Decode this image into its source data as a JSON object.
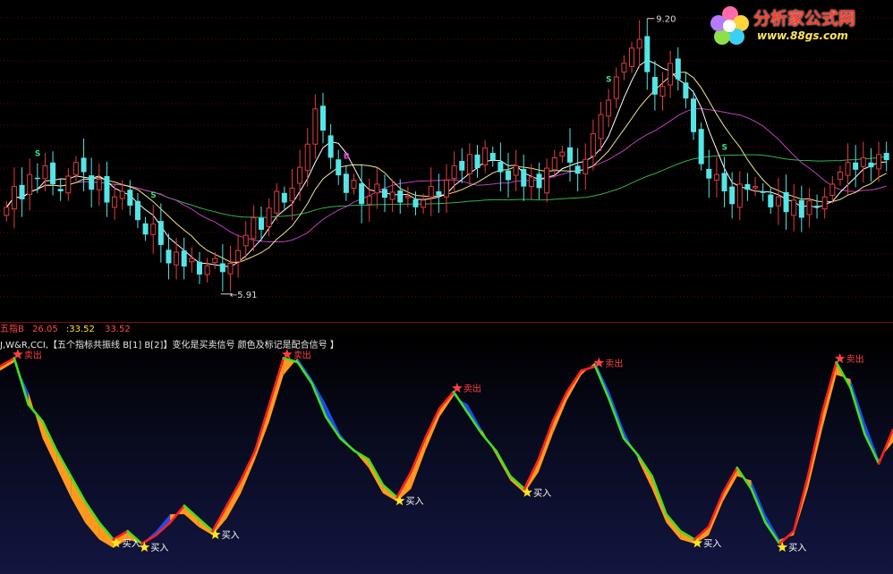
{
  "logo": {
    "name": "分析家公式网",
    "url": "www.88gs.com"
  },
  "main_chart": {
    "high_label": "9.20",
    "low_label": "5.91",
    "signal_s": "S",
    "signal_b": "B"
  },
  "sub_header": {
    "name": "五指B",
    "v1": "26.05",
    "v2": ":33.52",
    "v3": "33.52"
  },
  "sub_title": "J,W&R,CCI,【五个指标共振线 B[1] B[2]】变化是买卖信号 颜色及标记是配合信号 】",
  "colors": {
    "up": "#e23d3d",
    "down": "#54e5e7",
    "ma5": "#ffffff",
    "ma10": "#f0e68c",
    "ma20": "#c13ec1",
    "ma60": "#34b34a",
    "fill_up": "#ff9a1f",
    "fill_down": "#1f4df0",
    "line_rise": "#ff2020",
    "line_fall": "#40e020",
    "sell_star": "#ff4040",
    "buy_star": "#ffe81a"
  },
  "chart_data": [
    {
      "type": "candlestick",
      "title": "",
      "annotations": [
        {
          "text": "9.20",
          "type": "high"
        },
        {
          "text": "5.91",
          "type": "low"
        }
      ],
      "ylim": [
        5.6,
        9.4
      ],
      "series": [
        {
          "values": [
            6.92,
            7.18,
            7.02,
            7.33,
            7.28,
            7.44,
            7.21,
            7.12,
            7.31,
            7.48,
            7.36,
            7.14,
            7.27,
            6.98,
            7.05,
            7.12,
            6.94,
            6.76,
            6.58,
            6.71,
            6.45,
            6.22,
            6.36,
            6.18,
            6.28,
            6.08,
            6.19,
            6.28,
            6.11,
            6.22,
            6.38,
            6.57,
            6.79,
            6.64,
            6.91,
            7.12,
            6.98,
            7.16,
            7.42,
            7.71,
            8.15,
            7.88,
            7.54,
            7.32,
            7.1,
            7.26,
            6.96,
            7.06,
            7.21,
            7.04,
            7.11,
            6.98,
            7.06,
            6.92,
            7.01,
            7.18,
            7.07,
            7.26,
            7.44,
            7.38,
            7.58,
            7.41,
            7.66,
            7.51,
            7.36,
            7.26,
            7.44,
            7.18,
            7.3,
            7.16,
            7.41,
            7.54,
            7.61,
            7.48,
            7.34,
            7.52,
            7.84,
            8.08,
            8.26,
            8.55,
            8.72,
            8.91,
            9.02,
            8.61,
            8.33,
            8.43,
            8.72,
            8.52,
            8.28,
            7.86,
            7.46,
            7.28,
            7.33,
            7.12,
            6.96,
            7.21,
            7.14,
            7.18,
            7.1,
            6.92,
            7.05,
            6.86,
            7.01,
            6.79,
            7.0,
            6.92,
            7.05,
            7.21,
            7.36,
            7.48,
            7.39,
            7.54,
            7.42,
            7.58,
            7.51
          ]
        }
      ]
    },
    {
      "type": "area",
      "title": "五指B",
      "ylim": [
        0,
        100
      ],
      "series": [
        {
          "name": "B[1]",
          "values": [
            92,
            96,
            74,
            66,
            52,
            40,
            28,
            18,
            10,
            14,
            8,
            12,
            18,
            26,
            20,
            14,
            26,
            38,
            52,
            74,
            96,
            94,
            84,
            68,
            58,
            52,
            48,
            36,
            30,
            42,
            58,
            72,
            80,
            70,
            60,
            52,
            40,
            34,
            48,
            66,
            80,
            90,
            92,
            76,
            58,
            50,
            40,
            22,
            14,
            10,
            16,
            32,
            44,
            34,
            18,
            8,
            14,
            40,
            70,
            94,
            82,
            60,
            46,
            62
          ]
        },
        {
          "name": "B[2]",
          "values": [
            90,
            94,
            80,
            58,
            44,
            30,
            18,
            10,
            6,
            10,
            8,
            14,
            22,
            22,
            16,
            12,
            20,
            32,
            48,
            66,
            88,
            96,
            86,
            74,
            60,
            52,
            44,
            32,
            28,
            34,
            52,
            68,
            78,
            74,
            62,
            50,
            38,
            32,
            42,
            60,
            76,
            88,
            94,
            80,
            62,
            48,
            34,
            18,
            10,
            8,
            12,
            28,
            40,
            38,
            22,
            10,
            12,
            34,
            62,
            88,
            86,
            66,
            48,
            56
          ]
        }
      ],
      "annotations": [
        {
          "text": "卖出"
        },
        {
          "text": "买入"
        }
      ]
    }
  ]
}
